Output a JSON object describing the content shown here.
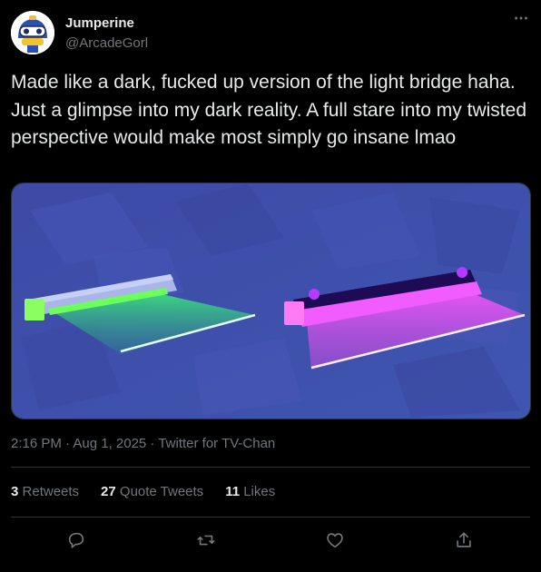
{
  "user": {
    "display_name": "Jumperine",
    "handle": "@ArcadeGorl",
    "avatar_icon": "robot-mascot-avatar"
  },
  "tweet": {
    "text": "Made like a dark, fucked up version of the light bridge haha. Just a glimpse into my dark reality. A full stare into my twisted perspective would make most simply go insane lmao",
    "media_description_icon": "light-bridge-render-image"
  },
  "meta": {
    "timestamp": "2:16 PM · Aug 1, 2025 · Twitter for TV-Chan"
  },
  "stats": [
    {
      "count": "3",
      "label": "Retweets"
    },
    {
      "count": "27",
      "label": "Quote Tweets"
    },
    {
      "count": "11",
      "label": "Likes"
    }
  ],
  "actions": {
    "reply_icon": "reply-icon",
    "retweet_icon": "retweet-icon",
    "like_icon": "heart-icon",
    "share_icon": "share-icon"
  },
  "colors": {
    "background": "#000000",
    "text_primary": "#e7e9ea",
    "text_secondary": "#71767b",
    "divider": "#2f3336",
    "green_bridge": "#4cff6e",
    "purple_bridge": "#e04cff"
  }
}
